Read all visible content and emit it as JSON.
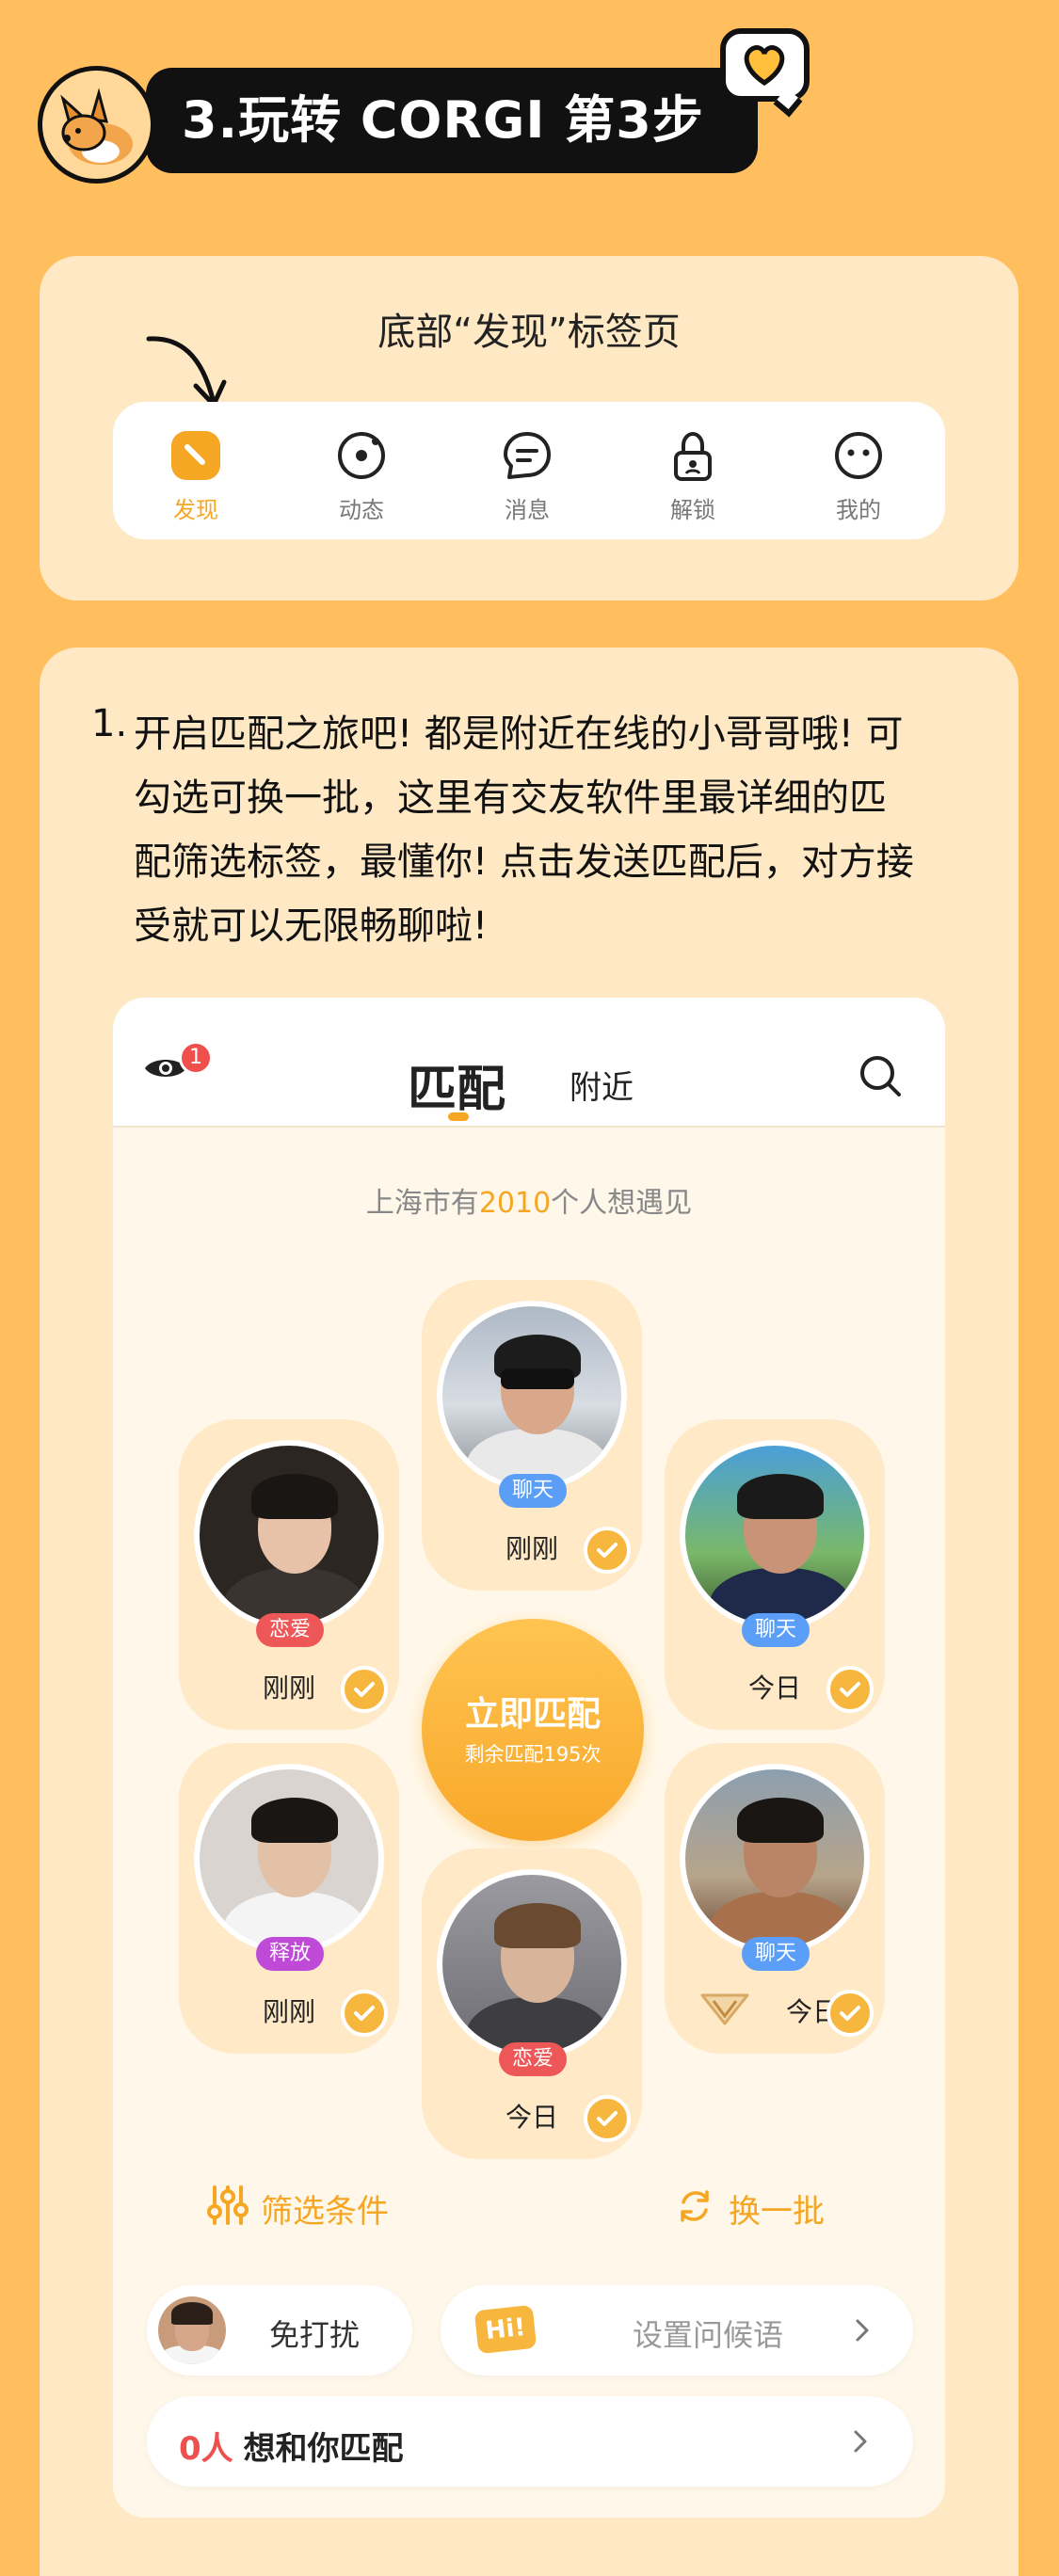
{
  "header": {
    "title": "3.玩转 CORGI 第3步"
  },
  "section1": {
    "title": "底部“发现”标签页",
    "tabs": [
      {
        "label": "发现",
        "icon": "discover-icon",
        "active": true
      },
      {
        "label": "动态",
        "icon": "moments-icon",
        "active": false
      },
      {
        "label": "消息",
        "icon": "message-icon",
        "active": false
      },
      {
        "label": "解锁",
        "icon": "lock-icon",
        "active": false
      },
      {
        "label": "我的",
        "icon": "profile-icon",
        "active": false
      }
    ]
  },
  "section2": {
    "number": "1.",
    "lines": [
      "开启匹配之旅吧! 都是附近在线的小哥哥哦! 可",
      "勾选可换一批，这里有交友软件里最详细的匹",
      "配筛选标签，最懂你! 点击发送匹配后，对方接",
      "受就可以无限畅聊啦!"
    ]
  },
  "phone": {
    "eye_badge": "1",
    "tab_match": "匹配",
    "tab_nearby": "附近",
    "city": {
      "prefix": "上海市有",
      "count": "2010",
      "suffix": "个人想遇见"
    },
    "profiles": [
      {
        "tag": "聊天",
        "tag_type": "chat",
        "time": "刚刚"
      },
      {
        "tag": "恋爱",
        "tag_type": "love",
        "time": "刚刚"
      },
      {
        "tag": "聊天",
        "tag_type": "chat",
        "time": "今日"
      },
      {
        "tag": "释放",
        "tag_type": "free",
        "time": "刚刚"
      },
      {
        "tag": "聊天",
        "tag_type": "chat",
        "time": "今日"
      },
      {
        "tag": "恋爱",
        "tag_type": "love",
        "time": "今日"
      }
    ],
    "match_button": {
      "label": "立即匹配",
      "sub": "剩余匹配195次"
    },
    "filter_label": "筛选条件",
    "refresh_label": "换一批",
    "dnd_label": "免打扰",
    "greeting": {
      "badge": "Hi!",
      "label": "设置问候语"
    },
    "wants": {
      "count": "0人",
      "label": "想和你匹配"
    }
  },
  "colors": {
    "background": "#ffbf5f",
    "accent": "#f5a623",
    "card": "#ffe8c4"
  }
}
